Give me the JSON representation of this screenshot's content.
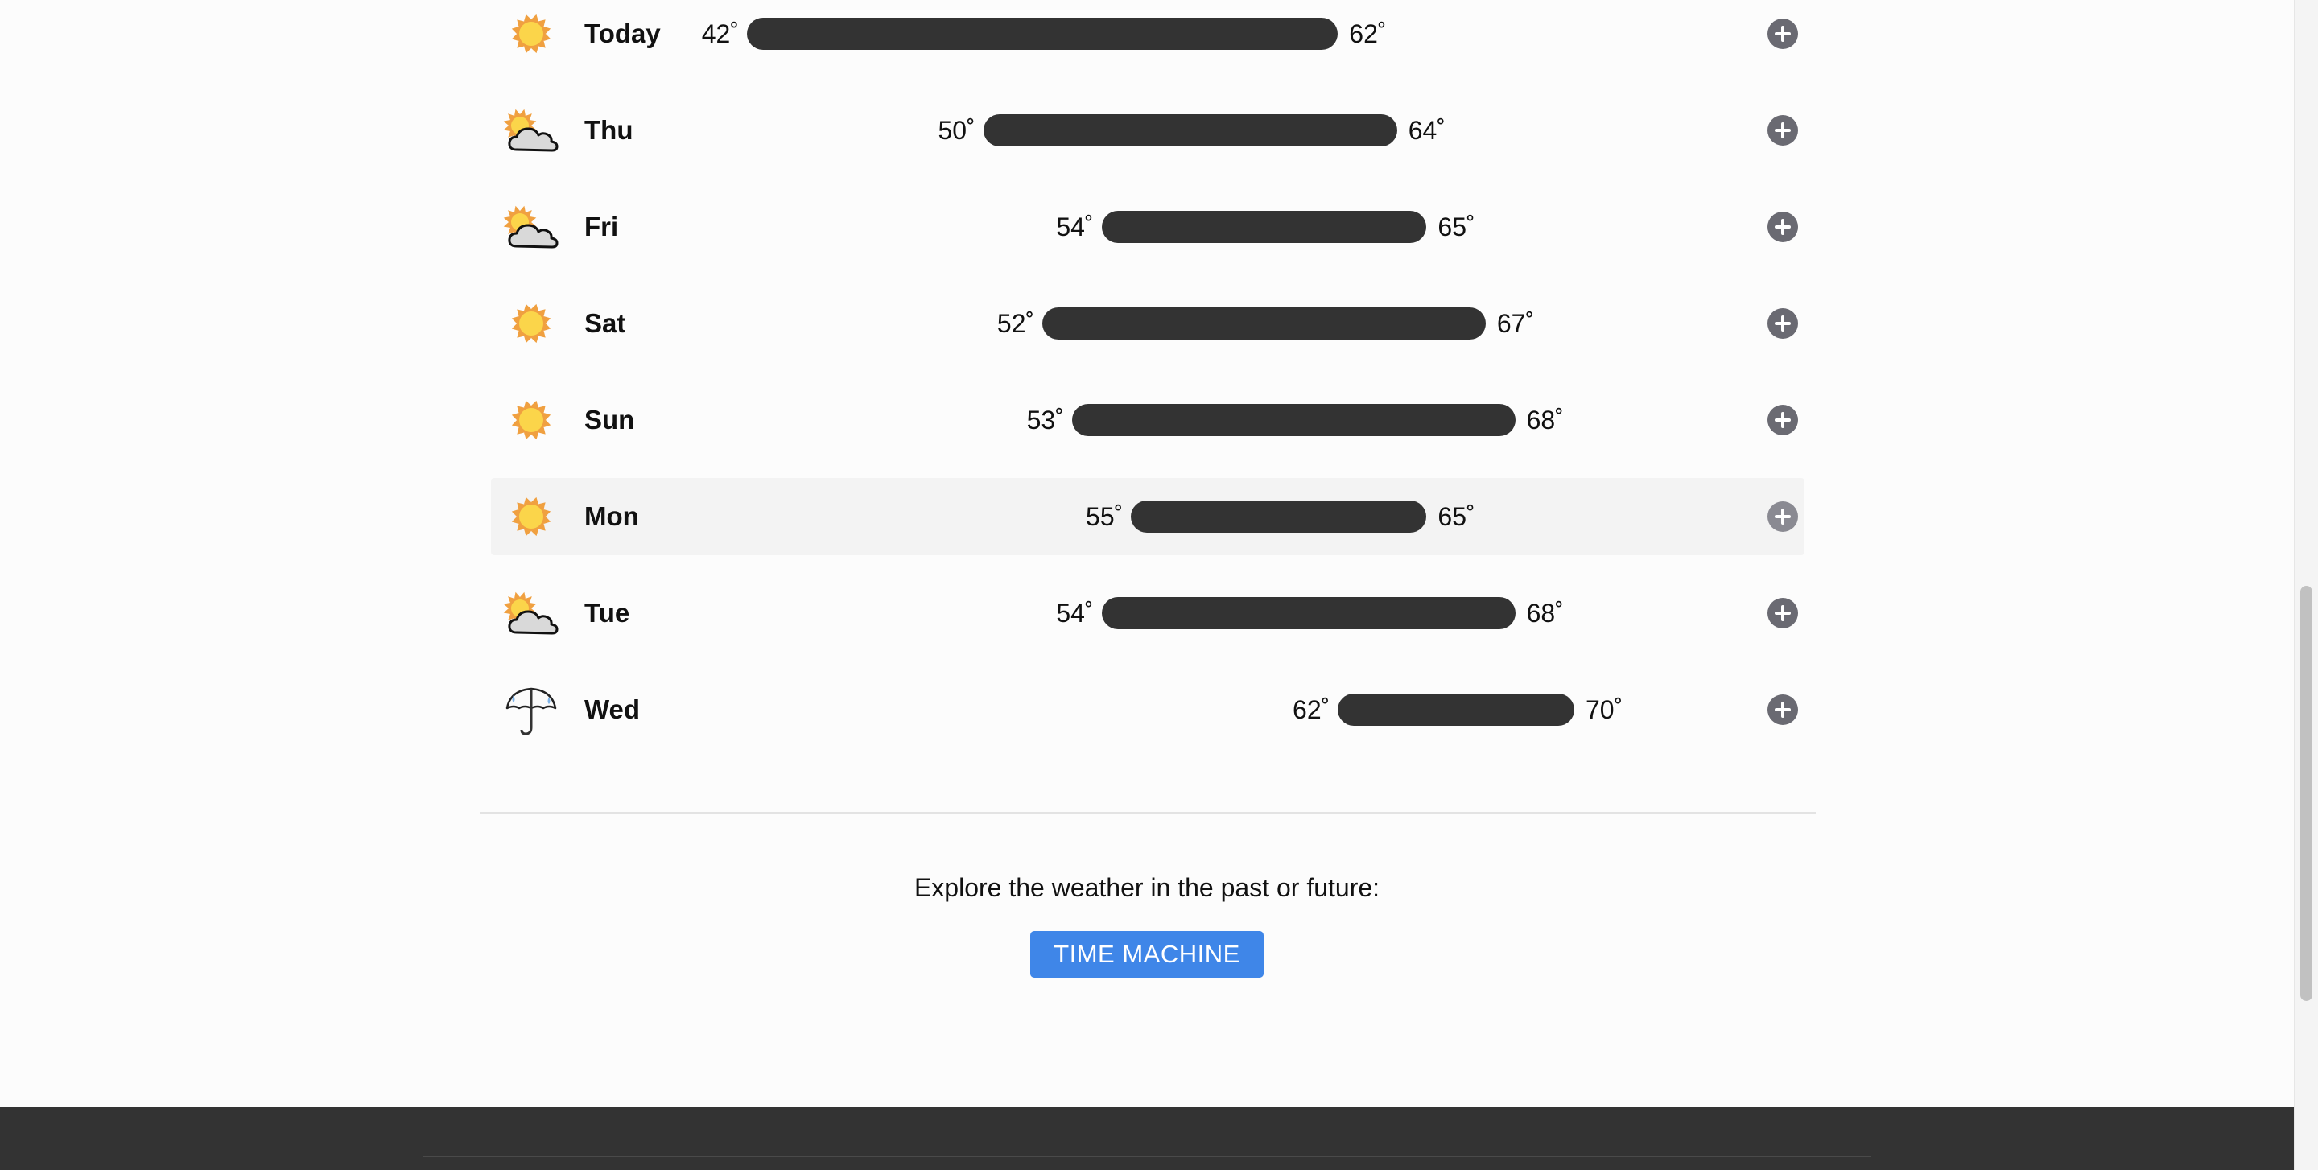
{
  "forecast": {
    "range_min": 42,
    "range_max": 70,
    "days": [
      {
        "name": "Today",
        "icon": "sun-icon",
        "low": 42,
        "high": 62,
        "low_label": "42˚",
        "high_label": "62˚"
      },
      {
        "name": "Thu",
        "icon": "partly-cloudy-icon",
        "low": 50,
        "high": 64,
        "low_label": "50˚",
        "high_label": "64˚"
      },
      {
        "name": "Fri",
        "icon": "partly-cloudy-icon",
        "low": 54,
        "high": 65,
        "low_label": "54˚",
        "high_label": "65˚"
      },
      {
        "name": "Sat",
        "icon": "sun-icon",
        "low": 52,
        "high": 67,
        "low_label": "52˚",
        "high_label": "67˚"
      },
      {
        "name": "Sun",
        "icon": "sun-icon",
        "low": 53,
        "high": 68,
        "low_label": "53˚",
        "high_label": "68˚"
      },
      {
        "name": "Mon",
        "icon": "sun-icon",
        "low": 55,
        "high": 65,
        "low_label": "55˚",
        "high_label": "65˚",
        "hovered": true
      },
      {
        "name": "Tue",
        "icon": "partly-cloudy-icon",
        "low": 54,
        "high": 68,
        "low_label": "54˚",
        "high_label": "68˚"
      },
      {
        "name": "Wed",
        "icon": "rain-umbrella-icon",
        "low": 62,
        "high": 70,
        "low_label": "62˚",
        "high_label": "70˚"
      }
    ]
  },
  "time_machine": {
    "prompt": "Explore the weather in the past or future:",
    "button_label": "TIME MACHINE",
    "button_color": "#3f86e8"
  },
  "colors": {
    "bar": "#333333",
    "footer": "#333333",
    "sun_ray": "#f0a040",
    "sun_core": "#fbd54a"
  }
}
